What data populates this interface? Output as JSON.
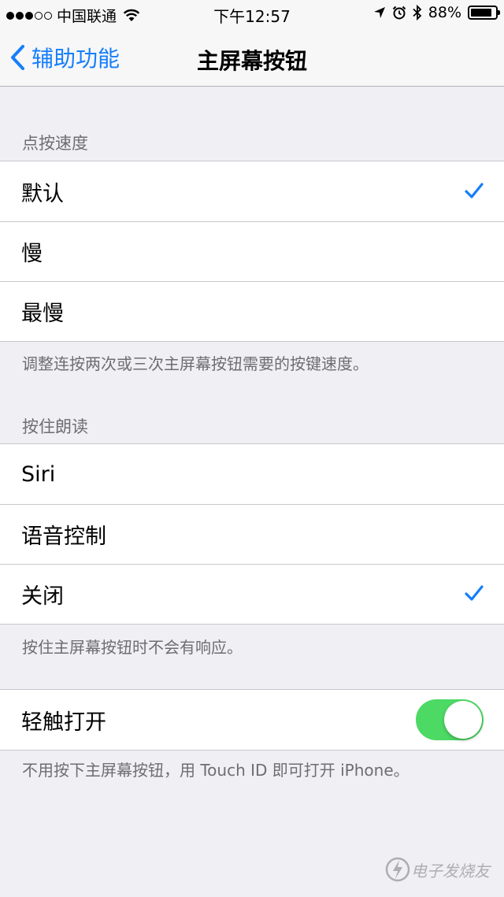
{
  "status_bar": {
    "carrier": "中国联通",
    "time": "下午12:57",
    "battery": "88%",
    "battery_level": 0.88,
    "signal_bars_filled": 3,
    "signal_bars_total": 5
  },
  "nav": {
    "back_label": "辅助功能",
    "title": "主屏幕按钮"
  },
  "click_speed": {
    "header": "点按速度",
    "options": [
      {
        "label": "默认",
        "selected": true
      },
      {
        "label": "慢",
        "selected": false
      },
      {
        "label": "最慢",
        "selected": false
      }
    ],
    "footer": "调整连按两次或三次主屏幕按钮需要的按键速度。"
  },
  "press_hold": {
    "header": "按住朗读",
    "options": [
      {
        "label": "Siri",
        "selected": false
      },
      {
        "label": "语音控制",
        "selected": false
      },
      {
        "label": "关闭",
        "selected": true
      }
    ],
    "footer": "按住主屏幕按钮时不会有响应。"
  },
  "rest_finger": {
    "label": "轻触打开",
    "enabled": true,
    "footer": "不用按下主屏幕按钮，用 Touch ID 即可打开 iPhone。"
  },
  "watermark": {
    "text": "电子发烧友"
  },
  "colors": {
    "accent": "#157efb",
    "toggle_on": "#4cd964",
    "background": "#efeff4",
    "secondary_text": "#6d6d72"
  },
  "icons": {
    "back": "chevron-left-icon",
    "check": "checkmark-icon",
    "wifi": "wifi-icon",
    "location": "location-arrow-icon",
    "alarm": "alarm-clock-icon",
    "bluetooth": "bluetooth-icon",
    "battery": "battery-icon"
  }
}
